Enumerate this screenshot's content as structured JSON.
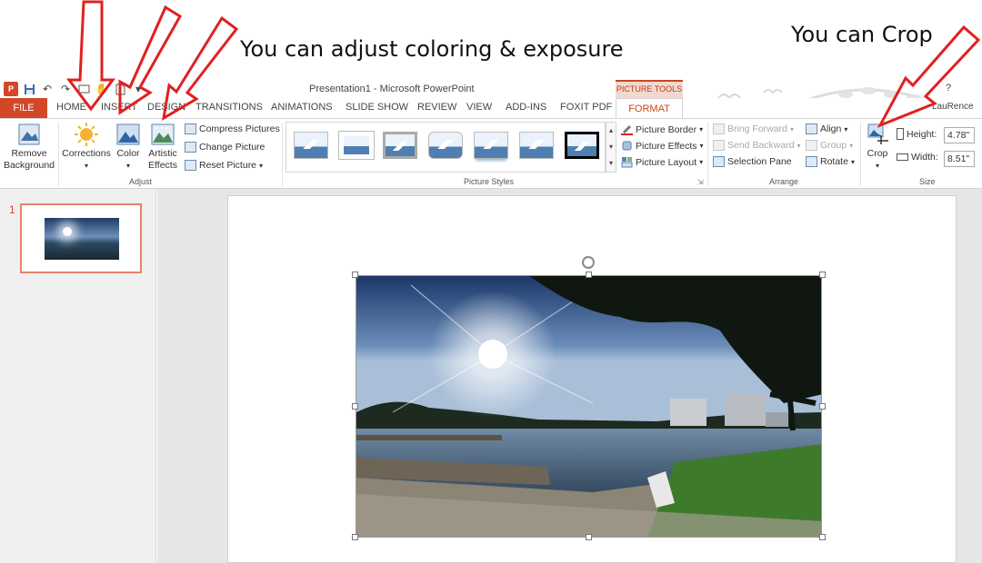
{
  "annotations": {
    "caption_adjust": "You can adjust coloring & exposure",
    "caption_crop": "You can Crop"
  },
  "titlebar": {
    "app_icon": "P",
    "document_title": "Presentation1 - Microsoft PowerPoint",
    "context_tab_group": "PICTURE TOOLS",
    "help": "?"
  },
  "tabs": {
    "file": "FILE",
    "items": [
      "HOME",
      "INSERT",
      "DESIGN",
      "TRANSITIONS",
      "ANIMATIONS",
      "SLIDE SHOW",
      "REVIEW",
      "VIEW",
      "ADD-INS",
      "FOXIT PDF"
    ],
    "active": "FORMAT",
    "user": "LauRence"
  },
  "ribbon": {
    "adjust": {
      "remove_background": "Remove Background",
      "corrections": "Corrections",
      "color": "Color",
      "artistic_effects": "Artistic Effects",
      "compress_pictures": "Compress Pictures",
      "change_picture": "Change Picture",
      "reset_picture": "Reset Picture",
      "group_label": "Adjust"
    },
    "picture_styles": {
      "picture_border": "Picture Border",
      "picture_effects": "Picture Effects",
      "picture_layout": "Picture Layout",
      "group_label": "Picture Styles"
    },
    "arrange": {
      "bring_forward": "Bring Forward",
      "send_backward": "Send Backward",
      "selection_pane": "Selection Pane",
      "align": "Align",
      "group": "Group",
      "rotate": "Rotate",
      "group_label": "Arrange"
    },
    "size": {
      "crop": "Crop",
      "height_label": "Height:",
      "height_value": "4.78\"",
      "width_label": "Width:",
      "width_value": "8.51\"",
      "group_label": "Size"
    }
  },
  "slides_pane": {
    "slide_number": "1"
  },
  "colors": {
    "accent": "#d24726",
    "arrow": "#e02020"
  }
}
